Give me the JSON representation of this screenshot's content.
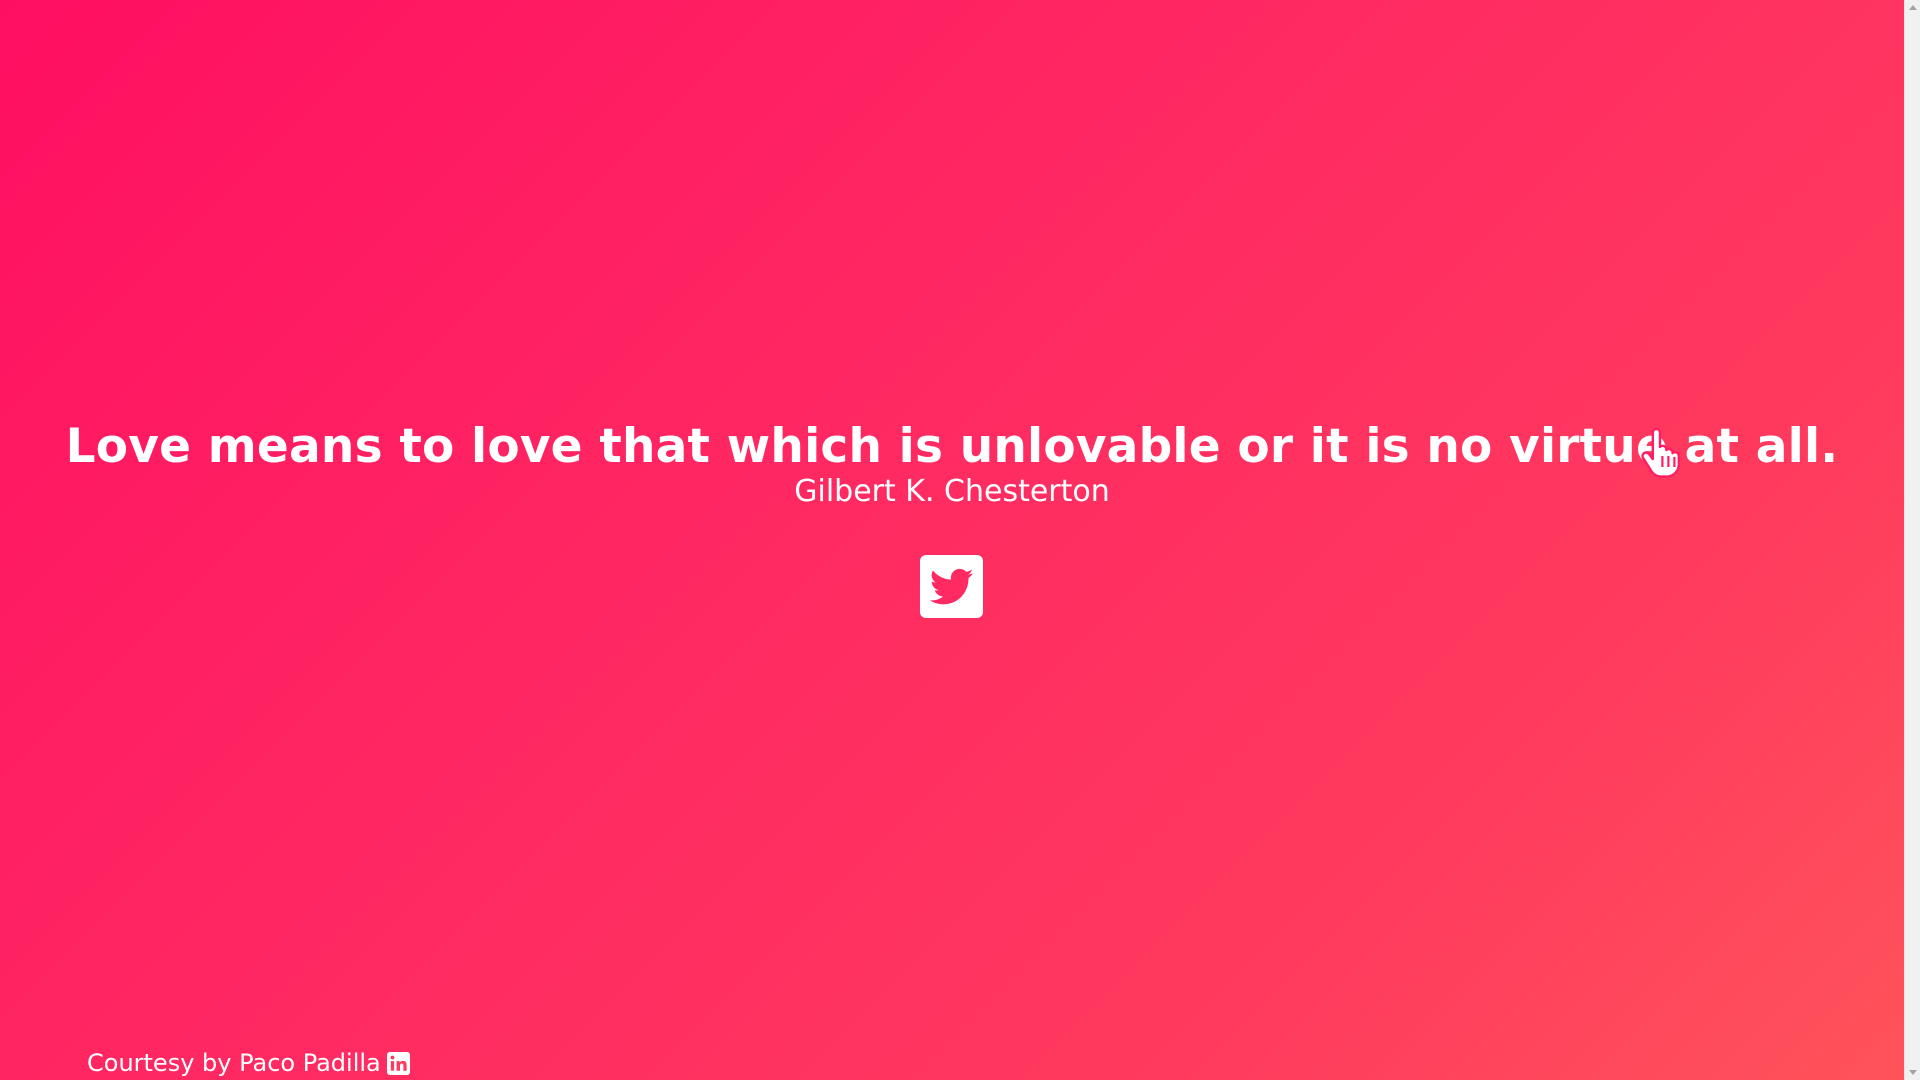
{
  "quote": {
    "text": "Love means to love that which is unlovable or it is no virtue at all.",
    "author": "Gilbert K. Chesterton"
  },
  "share": {
    "icon": "twitter-icon"
  },
  "footer": {
    "credit": "Courtesy by Paco Padilla",
    "icon": "linkedin-icon"
  },
  "colors": {
    "background_start": "#ff0f62",
    "background_end": "#ff545a",
    "text": "#ffffff"
  }
}
